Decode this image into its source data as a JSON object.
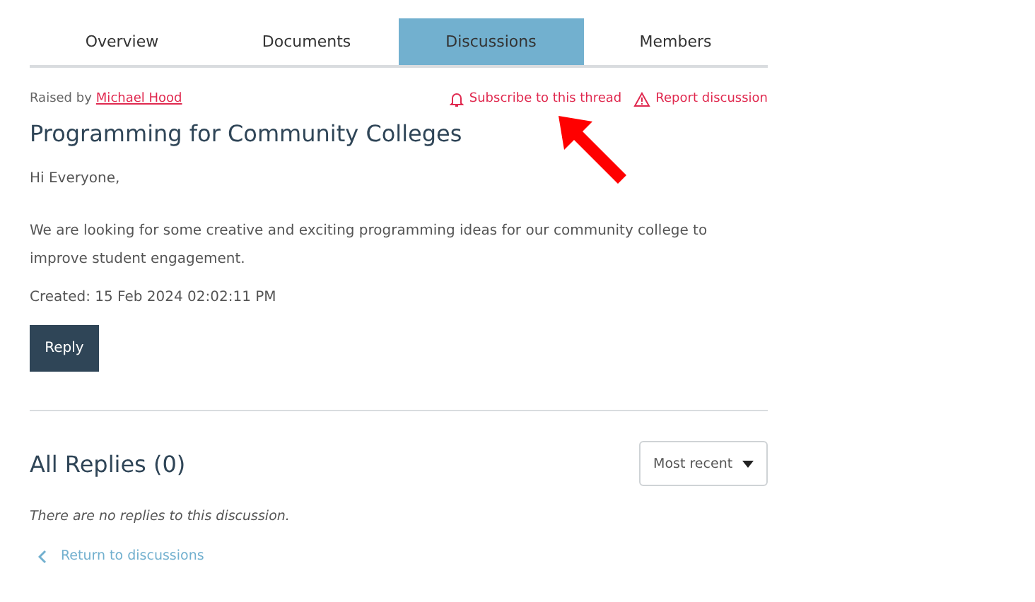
{
  "tabs": [
    {
      "label": "Overview",
      "selected": false
    },
    {
      "label": "Documents",
      "selected": false
    },
    {
      "label": "Discussions",
      "selected": true
    },
    {
      "label": "Members",
      "selected": false
    }
  ],
  "discussion": {
    "raised_by_label": "Raised by",
    "author": "Michael Hood",
    "subscribe": "Subscribe to this thread",
    "report": "Report discussion",
    "title": "Programming for Community Colleges",
    "body": [
      "Hi Everyone,",
      "We are looking for some creative and exciting programming ideas for our community college to improve student engagement."
    ],
    "created": "Created: 15 Feb 2024 02:02:11 PM",
    "reply_button": "Reply"
  },
  "replies": {
    "heading": "All Replies (0)",
    "sort": "Most recent",
    "empty": "There are no replies to this discussion.",
    "back_link": "Return to discussions"
  }
}
